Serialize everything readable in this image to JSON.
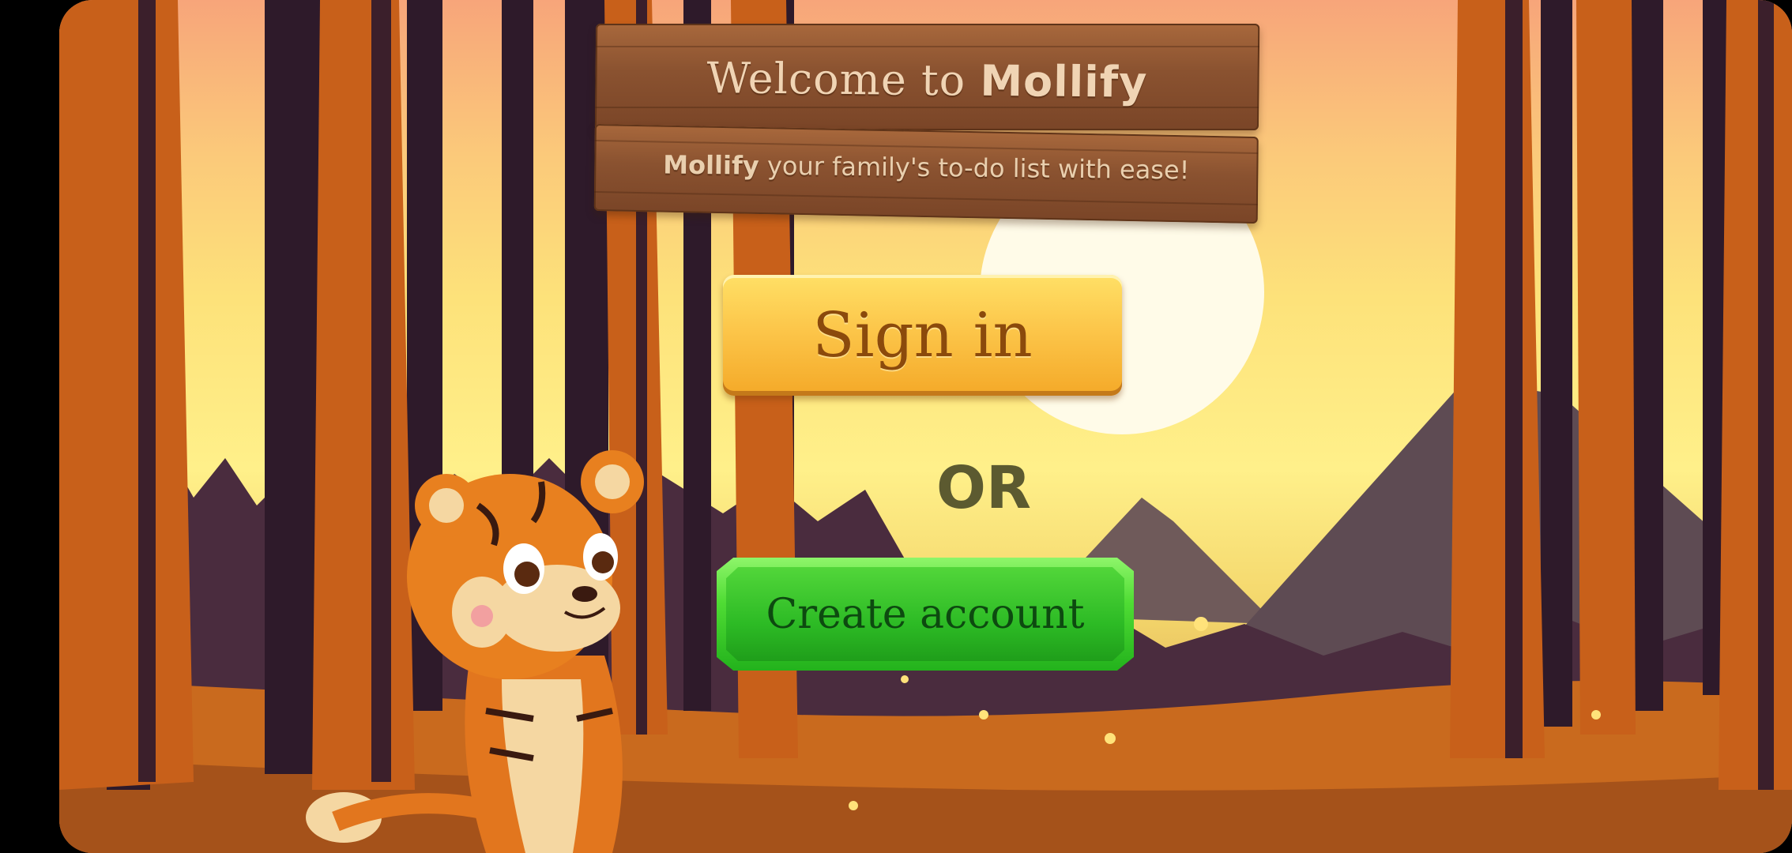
{
  "sign": {
    "welcome_prefix": "Welcome to",
    "brand": "Mollify",
    "tagline_brand": "Mollify",
    "tagline_rest": "your family's to-do list with ease!"
  },
  "actions": {
    "signin_label": "Sign in",
    "or_label": "OR",
    "create_account_label": "Create account"
  },
  "colors": {
    "signin_button": "#fcc64a",
    "create_button": "#2dbb25",
    "or_text": "#5c5a30"
  },
  "icons": {
    "mascot": "tiger-mascot-waving"
  }
}
